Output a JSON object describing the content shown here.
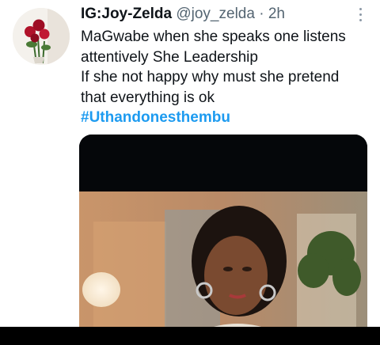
{
  "tweet": {
    "display_name": "IG:Joy-Zelda",
    "handle": "@joy_zelda",
    "separator": "·",
    "time": "2h",
    "lines": [
      "MaGwabe when she speaks one listens",
      "attentively She Leadership",
      "If she not happy why must she pretend",
      "that everything is ok"
    ],
    "hashtag": "#Uthandonesthembu"
  },
  "icons": {
    "more": "more-vertical-icon"
  },
  "colors": {
    "text": "#0f1419",
    "secondary": "#536471",
    "link": "#1d9bf0"
  }
}
